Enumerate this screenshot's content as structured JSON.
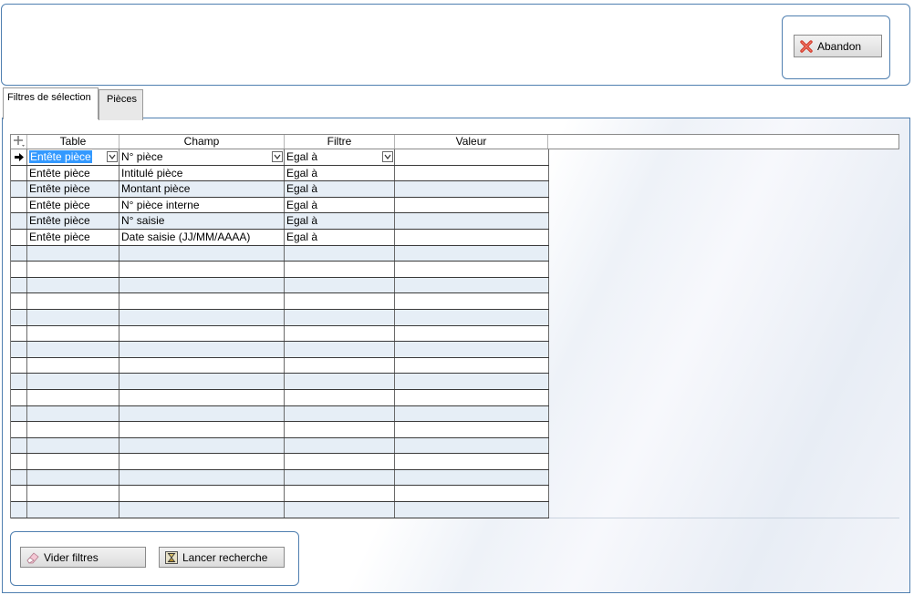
{
  "header": {
    "abandon_label": "Abandon",
    "abandon_icon": "red-x-icon"
  },
  "tabs": [
    {
      "label": "Filtres de sélection",
      "active": true
    },
    {
      "label": "Pièces",
      "active": false
    }
  ],
  "grid": {
    "columns": [
      "Table",
      "Champ",
      "Filtre",
      "Valeur"
    ],
    "corner_icon": "add-row-icon",
    "rows": [
      {
        "table": "Entête pièce",
        "champ": "N° pièce",
        "filtre": "Egal à",
        "valeur": ""
      },
      {
        "table": "Entête pièce",
        "champ": "Intitulé pièce",
        "filtre": "Egal à",
        "valeur": ""
      },
      {
        "table": "Entête pièce",
        "champ": "Montant pièce",
        "filtre": "Egal à",
        "valeur": ""
      },
      {
        "table": "Entête pièce",
        "champ": "N° pièce interne",
        "filtre": "Egal à",
        "valeur": ""
      },
      {
        "table": "Entête pièce",
        "champ": "N° saisie",
        "filtre": "Egal à",
        "valeur": ""
      },
      {
        "table": "Entête pièce",
        "champ": "Date saisie (JJ/MM/AAAA)",
        "filtre": "Egal à",
        "valeur": ""
      }
    ],
    "empty_row_count": 17
  },
  "actions": {
    "vider_label": "Vider filtres",
    "lancer_label": "Lancer recherche",
    "vider_icon": "eraser-icon",
    "lancer_icon": "hourglass-icon"
  },
  "colors": {
    "accent_border": "#4f7fb0",
    "selection": "#3399ff",
    "alt_row": "#e6eef6"
  }
}
